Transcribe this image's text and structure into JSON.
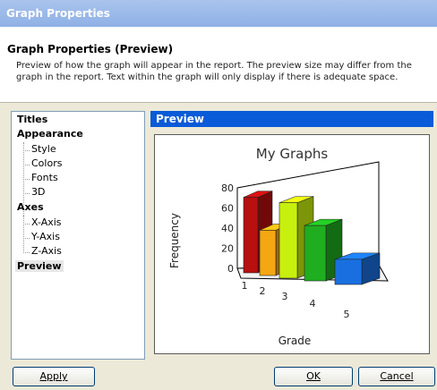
{
  "window": {
    "title": "Graph Properties"
  },
  "header": {
    "title": "Graph Properties (Preview)",
    "description": "Preview of how the graph will appear in the report. The preview size may differ from the graph in the report. Text within the graph will only display if there is adequate space."
  },
  "tree": {
    "titles": "Titles",
    "appearance": "Appearance",
    "style": "Style",
    "colors": "Colors",
    "fonts": "Fonts",
    "three_d": "3D",
    "axes": "Axes",
    "x_axis": "X-Axis",
    "y_axis": "Y-Axis",
    "z_axis": "Z-Axis",
    "preview": "Preview"
  },
  "panel": {
    "title": "Preview"
  },
  "chart_data": {
    "type": "bar",
    "title": "My Graphs",
    "xlabel": "Grade",
    "ylabel": "Frequency",
    "categories": [
      "1",
      "2",
      "3",
      "4",
      "5"
    ],
    "values": [
      75,
      45,
      75,
      55,
      25
    ],
    "yticks": [
      0,
      20,
      40,
      60,
      80
    ],
    "ylim": [
      0,
      80
    ],
    "colors": [
      "#b80f0f",
      "#f5a712",
      "#c8f00f",
      "#1fae1f",
      "#1a6fe0"
    ],
    "three_d": true
  },
  "buttons": {
    "apply": "Apply",
    "ok": "OK",
    "cancel": "Cancel"
  }
}
